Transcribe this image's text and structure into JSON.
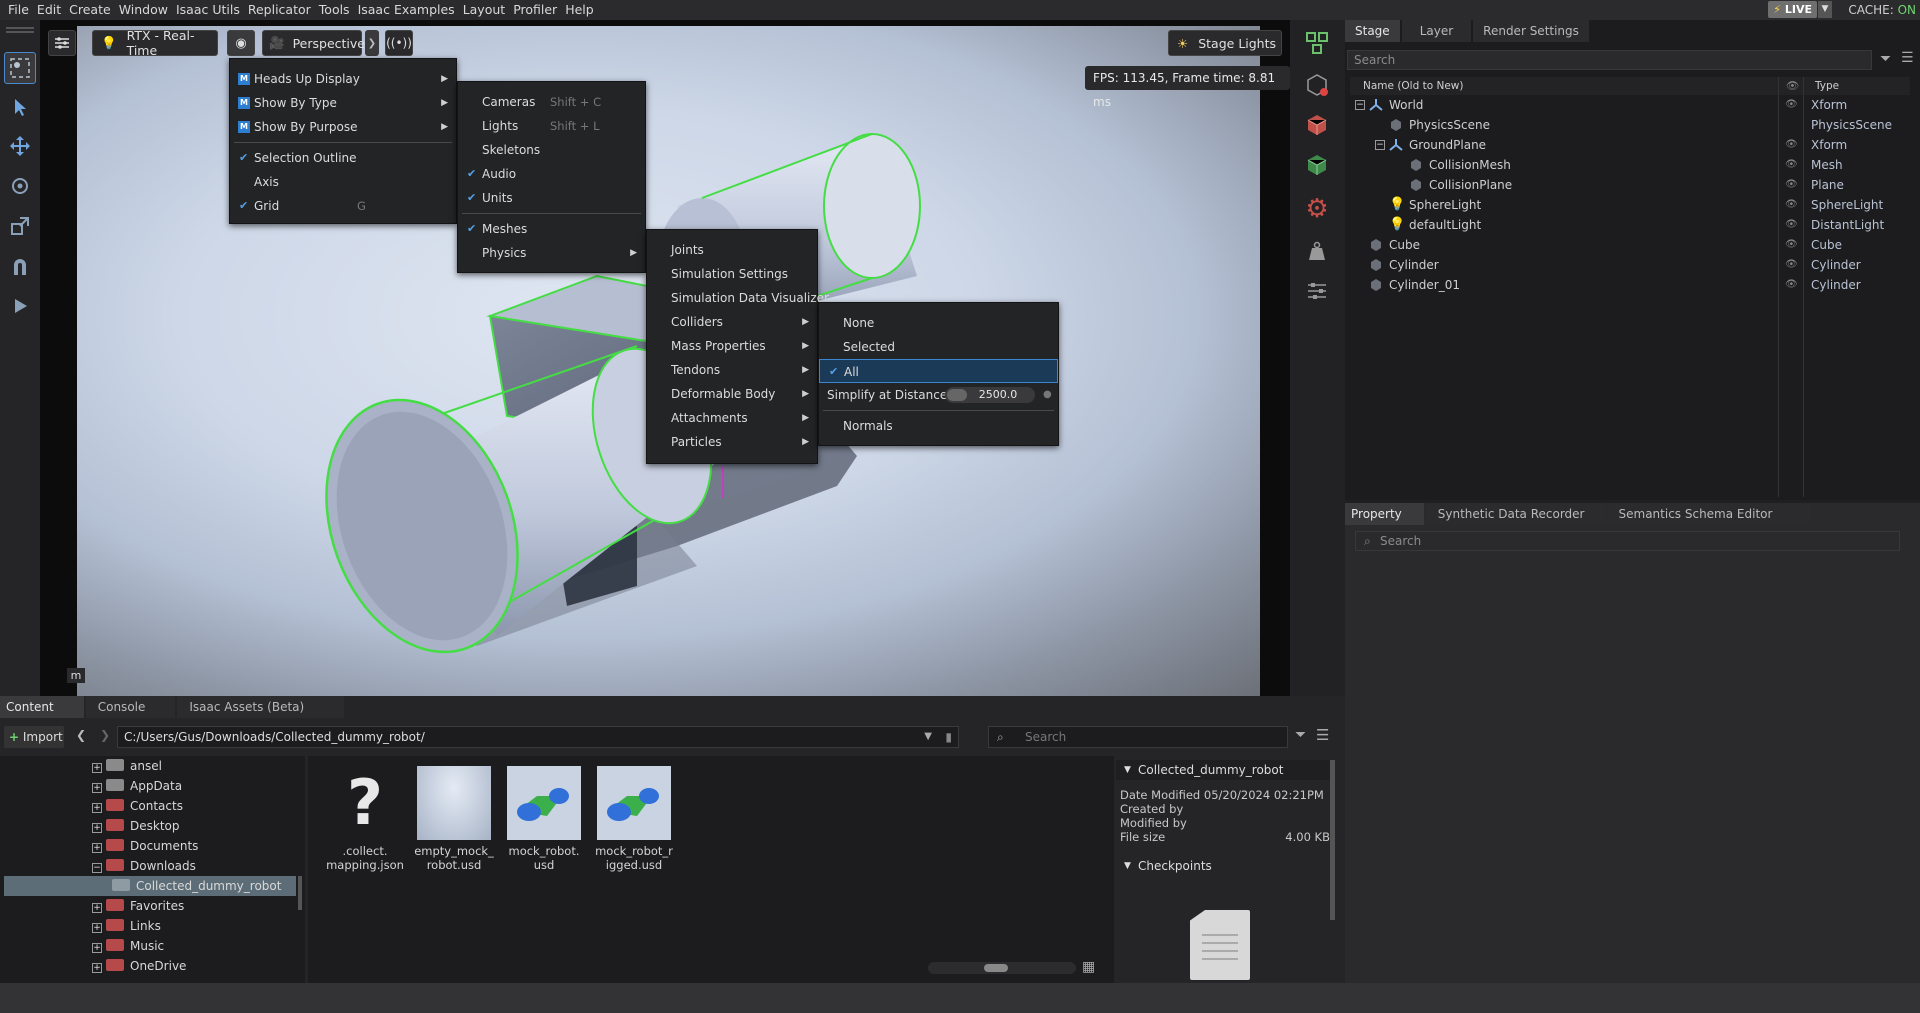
{
  "menubar": {
    "items": [
      "File",
      "Edit",
      "Create",
      "Window",
      "Isaac Utils",
      "Replicator",
      "Tools",
      "Isaac Examples",
      "Layout",
      "Profiler",
      "Help"
    ],
    "live_label": "LIVE",
    "cache_label": "CACHE:",
    "cache_value": "ON"
  },
  "viewport": {
    "renderer_label": "RTX - Real-Time",
    "camera_label": "Perspective",
    "stage_lights_label": "Stage Lights",
    "fps_text": "FPS: 113.45, Frame time: 8.81 ms",
    "units_badge": "m"
  },
  "show_menu": {
    "items": [
      {
        "label": "Heads Up Display",
        "checked": false,
        "submenu": true,
        "brand": true
      },
      {
        "label": "Show By Type",
        "checked": false,
        "submenu": true,
        "brand": true
      },
      {
        "label": "Show By Purpose",
        "checked": false,
        "submenu": true,
        "brand": true
      },
      {
        "label": "Selection Outline",
        "checked": true
      },
      {
        "label": "Axis",
        "checked": false
      },
      {
        "label": "Grid",
        "checked": true,
        "shortcut": "G"
      }
    ]
  },
  "type_menu": {
    "items": [
      {
        "label": "Cameras",
        "shortcut": "Shift + C"
      },
      {
        "label": "Lights",
        "shortcut": "Shift + L"
      },
      {
        "label": "Skeletons"
      },
      {
        "label": "Audio",
        "checked": true
      },
      {
        "label": "Units",
        "checked": true
      },
      {
        "label": "Meshes",
        "checked": true
      },
      {
        "label": "Physics",
        "submenu": true
      }
    ]
  },
  "physics_menu": {
    "items": [
      "Joints",
      "Simulation Settings",
      "Simulation Data Visualizer",
      "Colliders",
      "Mass Properties",
      "Tendons",
      "Deformable Body",
      "Attachments",
      "Particles"
    ]
  },
  "colliders_menu": {
    "items": [
      "None",
      "Selected",
      "All"
    ],
    "selected": "All",
    "simplify_label": "Simplify at Distance",
    "simplify_value": "2500.0",
    "normals_label": "Normals"
  },
  "stage": {
    "tabs": [
      "Stage",
      "Layer",
      "Render Settings"
    ],
    "search_placeholder": "Search",
    "col_name": "Name (Old to New)",
    "col_type": "Type",
    "rows": [
      {
        "name": "World",
        "type": "Xform"
      },
      {
        "name": "PhysicsScene",
        "type": "PhysicsScene"
      },
      {
        "name": "GroundPlane",
        "type": "Xform"
      },
      {
        "name": "CollisionMesh",
        "type": "Mesh"
      },
      {
        "name": "CollisionPlane",
        "type": "Plane"
      },
      {
        "name": "SphereLight",
        "type": "SphereLight"
      },
      {
        "name": "defaultLight",
        "type": "DistantLight"
      },
      {
        "name": "Cube",
        "type": "Cube"
      },
      {
        "name": "Cylinder",
        "type": "Cylinder"
      },
      {
        "name": "Cylinder_01",
        "type": "Cylinder"
      }
    ]
  },
  "property": {
    "tabs": [
      "Property",
      "Synthetic Data Recorder",
      "Semantics Schema Editor"
    ],
    "search_placeholder": "Search"
  },
  "content": {
    "tabs": [
      "Content",
      "Console",
      "Isaac Assets (Beta)"
    ],
    "import_label": "Import",
    "path": "C:/Users/Gus/Downloads/Collected_dummy_robot/",
    "search_placeholder": "Search",
    "tree": [
      "ansel",
      "AppData",
      "Contacts",
      "Desktop",
      "Documents",
      "Downloads",
      "Collected_dummy_robot",
      "Favorites",
      "Links",
      "Music",
      "OneDrive"
    ],
    "files": [
      {
        "name": ".collect.\nmapping.json"
      },
      {
        "name": "empty_mock_\nrobot.usd"
      },
      {
        "name": "mock_robot.\nusd"
      },
      {
        "name": "mock_robot_r\nigged.usd"
      }
    ],
    "info": {
      "folder": "Collected_dummy_robot",
      "date_modified_label": "Date Modified",
      "date_modified": "05/20/2024 02:21PM",
      "created_by_label": "Created by",
      "modified_by_label": "Modified by",
      "file_size_label": "File size",
      "file_size": "4.00 KB",
      "checkpoints_label": "Checkpoints"
    }
  },
  "colors": {
    "accent": "#3a86d0",
    "selection_outline": "#44dd44",
    "live_on": "#6fd46f"
  }
}
